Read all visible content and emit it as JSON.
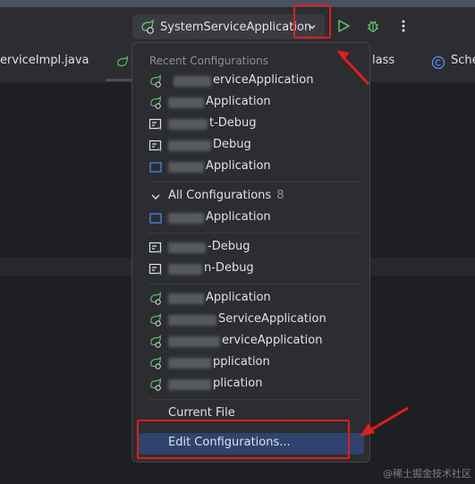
{
  "toolbar": {
    "run_config_label": "SystemServiceApplication",
    "icons": [
      "spring-boot-icon",
      "chevron-down-icon",
      "run-icon",
      "debug-icon",
      "more-vertical-icon"
    ]
  },
  "tabs": [
    {
      "label": "erviceImpl.java"
    },
    {
      "label": "lass"
    },
    {
      "label": "Sche"
    }
  ],
  "popup": {
    "recent_label": "Recent Configurations",
    "recent": [
      {
        "suffix": "erviceApplication",
        "icon": "spring-boot-icon"
      },
      {
        "suffix": "Application",
        "icon": "spring-boot-icon"
      },
      {
        "suffix": "t-Debug",
        "icon": "remote-debug-icon"
      },
      {
        "suffix": "Debug",
        "icon": "remote-debug-icon"
      },
      {
        "suffix": "Application",
        "icon": "application-icon"
      }
    ],
    "all_label": "All Configurations",
    "all_count": "8",
    "all": [
      {
        "suffix": "Application",
        "icon": "application-icon"
      },
      {
        "suffix": "-Debug",
        "icon": "remote-debug-icon"
      },
      {
        "suffix": "n-Debug",
        "icon": "remote-debug-icon"
      },
      {
        "suffix": "Application",
        "icon": "spring-boot-icon"
      },
      {
        "suffix": "ServiceApplication",
        "icon": "spring-boot-icon"
      },
      {
        "suffix": "erviceApplication",
        "icon": "spring-boot-icon"
      },
      {
        "suffix": "pplication",
        "icon": "spring-boot-icon"
      },
      {
        "suffix": "plication",
        "icon": "spring-boot-icon"
      }
    ],
    "current_file": "Current File",
    "edit_configurations": "Edit Configurations..."
  },
  "watermark": "@稀土掘金技术社区",
  "colors": {
    "accent_red": "#e11d1d",
    "selection": "#2e436e",
    "run_green": "#5fb865"
  }
}
